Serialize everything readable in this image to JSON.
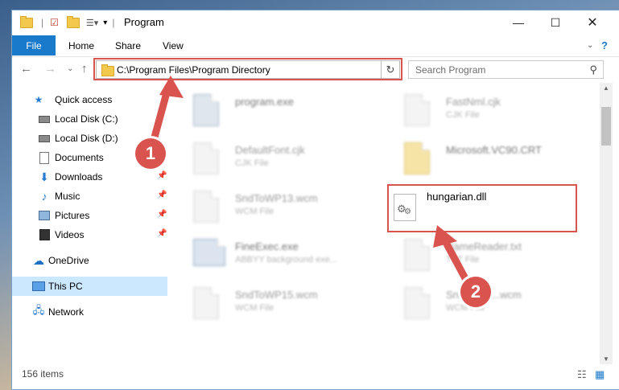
{
  "window": {
    "title": "Program"
  },
  "ribbon": {
    "tabs": [
      "File",
      "Home",
      "Share",
      "View"
    ]
  },
  "address_bar": {
    "path": "C:\\Program Files\\Program Directory"
  },
  "search": {
    "placeholder": "Search Program"
  },
  "sidebar": {
    "items": [
      {
        "label": "Quick access",
        "icon": "star-icon"
      },
      {
        "label": "Local Disk (C:)",
        "icon": "drive-icon"
      },
      {
        "label": "Local Disk (D:)",
        "icon": "drive-icon"
      },
      {
        "label": "Documents",
        "icon": "document-icon",
        "pinned": true
      },
      {
        "label": "Downloads",
        "icon": "download-icon",
        "pinned": true
      },
      {
        "label": "Music",
        "icon": "music-icon",
        "pinned": true
      },
      {
        "label": "Pictures",
        "icon": "pictures-icon",
        "pinned": true
      },
      {
        "label": "Videos",
        "icon": "video-icon",
        "pinned": true
      },
      {
        "label": "OneDrive",
        "icon": "cloud-icon"
      },
      {
        "label": "This PC",
        "icon": "pc-icon",
        "selected": true
      },
      {
        "label": "Network",
        "icon": "network-icon"
      }
    ]
  },
  "files": [
    {
      "name": "program.exe",
      "type": ""
    },
    {
      "name": "FastNml.cjk",
      "type": "CJK File"
    },
    {
      "name": "DefaultFont.cjk",
      "type": "CJK File"
    },
    {
      "name": "Microsoft.VC90.CRT",
      "type": ""
    },
    {
      "name": "SndToWP13.wcm",
      "type": "WCM File"
    },
    {
      "name": "hungarian.dll",
      "type": ""
    },
    {
      "name": "FineExec.exe",
      "type": "ABBYY background exe..."
    },
    {
      "name": "NameReader.txt",
      "type": "TXT File"
    },
    {
      "name": "SndToWP15.wcm",
      "type": "WCM File"
    },
    {
      "name": "SndToWP...wcm",
      "type": "WCM File"
    }
  ],
  "status": {
    "item_count": "156 items"
  },
  "callouts": [
    "1",
    "2"
  ],
  "colors": {
    "accent": "#1979ca",
    "highlight": "#d9534f",
    "selected": "#cce8ff"
  }
}
